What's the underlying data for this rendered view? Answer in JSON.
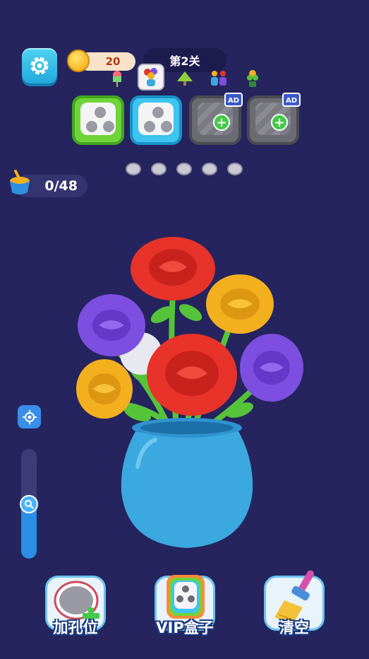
{
  "coins": {
    "value": "20"
  },
  "level": {
    "label": "第2关"
  },
  "paint_counter": {
    "value": "0/48"
  },
  "slider": {
    "level": 0.5
  },
  "boxes": [
    {
      "color": "green",
      "locked": false
    },
    {
      "color": "blue",
      "locked": false
    },
    {
      "locked": true,
      "badge": "AD"
    },
    {
      "locked": true,
      "badge": "AD"
    }
  ],
  "progress_dots": 5,
  "bottom_buttons": {
    "add_slot": "加孔位",
    "vip_box": "VIP盒子",
    "clear": "清空"
  },
  "colors": {
    "background": "#25245e",
    "red": "#e8332a",
    "yellow": "#f3b01e",
    "purple": "#7d4fe0",
    "vase": "#3ba8e0",
    "stem": "#56c43a"
  }
}
